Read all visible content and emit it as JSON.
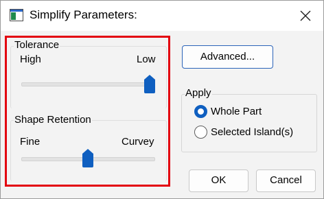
{
  "window": {
    "title": "Simplify Parameters:"
  },
  "tolerance": {
    "legend": "Tolerance",
    "min_label": "High",
    "max_label": "Low",
    "value": 1.0
  },
  "shape_retention": {
    "legend": "Shape Retention",
    "min_label": "Fine",
    "max_label": "Curvey",
    "value": 0.5
  },
  "buttons": {
    "advanced": "Advanced...",
    "ok": "OK",
    "cancel": "Cancel"
  },
  "apply": {
    "legend": "Apply",
    "options": [
      {
        "label": "Whole Part",
        "selected": true
      },
      {
        "label": "Selected Island(s)",
        "selected": false
      }
    ]
  },
  "colors": {
    "highlight_box": "#e3000f",
    "accent": "#0f5fc0"
  }
}
